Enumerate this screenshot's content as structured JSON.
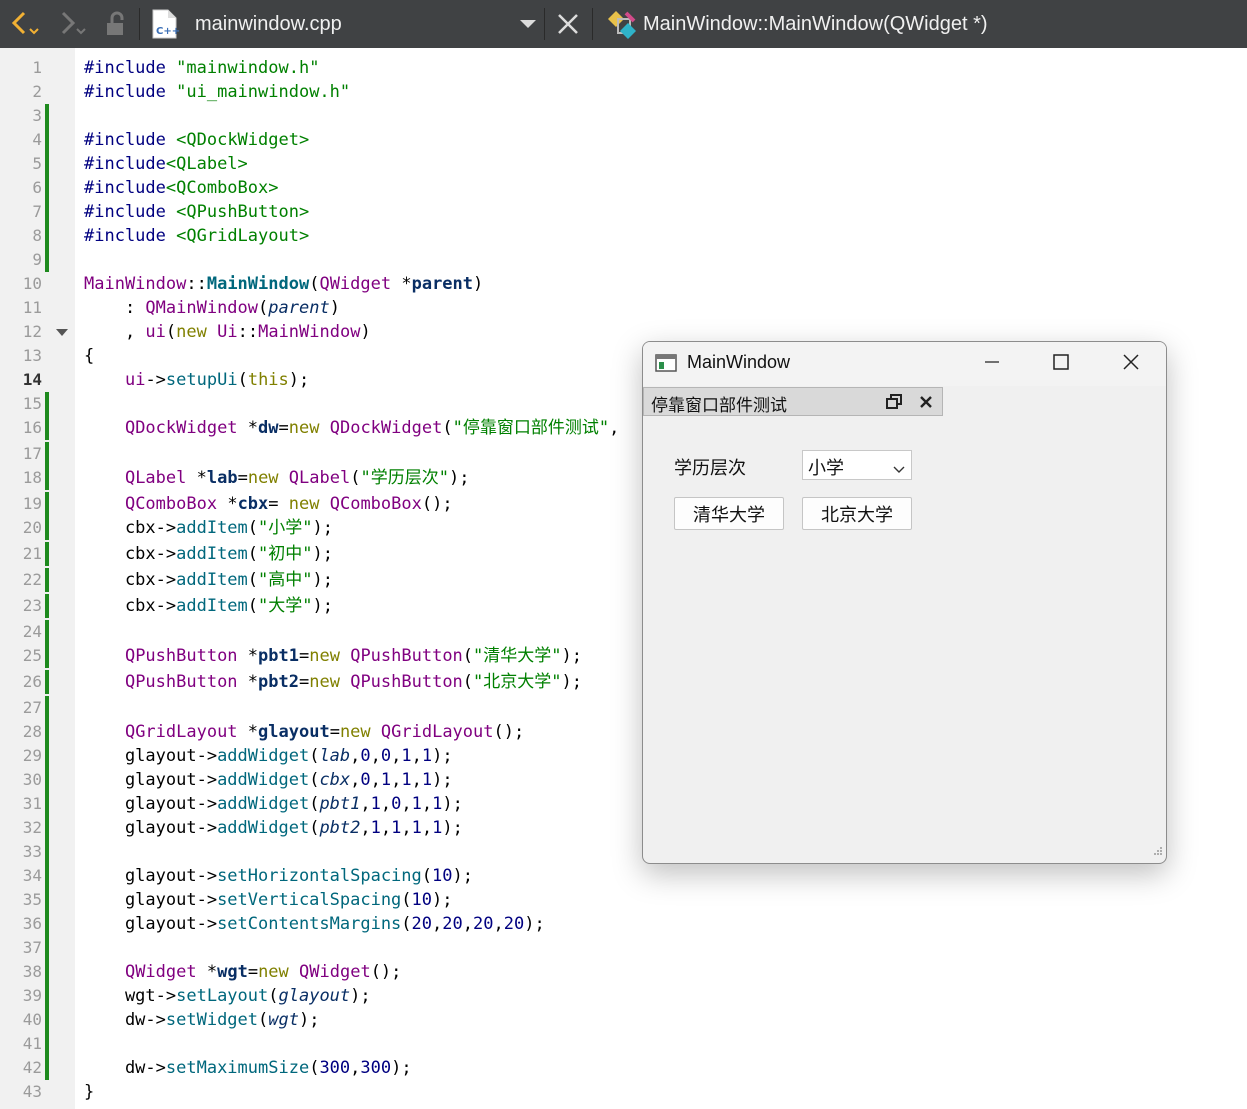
{
  "toolbar": {
    "file_name": "mainwindow.cpp",
    "symbol_name": "MainWindow::MainWindow(QWidget *)"
  },
  "icons": [
    "back-arrow-icon",
    "forward-arrow-icon",
    "lock-icon",
    "cpp-file-icon",
    "dropdown-arrow-icon",
    "close-icon",
    "symbol-icon"
  ],
  "editor": {
    "current_line": 14,
    "line_numbers": [
      "1",
      "2",
      "3",
      "4",
      "5",
      "6",
      "7",
      "8",
      "9",
      "10",
      "11",
      "12",
      "13",
      "14",
      "15",
      "16",
      "17",
      "18",
      "19",
      "20",
      "21",
      "22",
      "23",
      "24",
      "25",
      "26",
      "27",
      "28",
      "29",
      "30",
      "31",
      "32",
      "33",
      "34",
      "35",
      "36",
      "37",
      "38",
      "39",
      "40",
      "41",
      "42",
      "43"
    ]
  },
  "window": {
    "title": "MainWindow",
    "dock_title": "停靠窗口部件测试",
    "label": "学历层次",
    "combo_value": "小学",
    "button1": "清华大学",
    "button2": "北京大学"
  },
  "colors": {
    "toolbar_bg": "#404244",
    "change_marker": "#1e8a1e",
    "keyword": "#808000",
    "string": "#008000",
    "type": "#800080",
    "function": "#00677c"
  }
}
